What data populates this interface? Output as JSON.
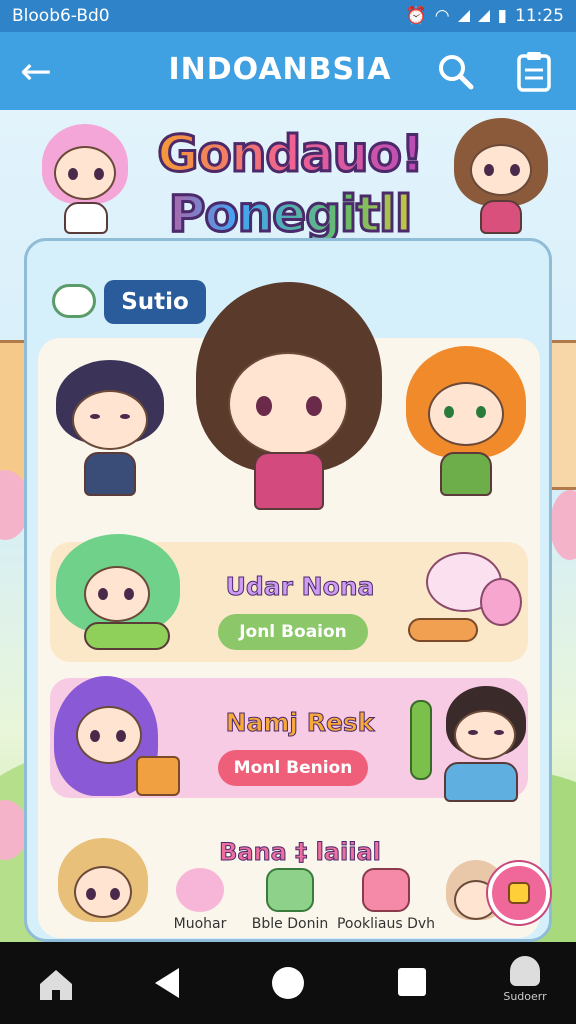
{
  "status_bar": {
    "left_text": "Bloob6-Bd0",
    "time": "11:25"
  },
  "app_bar": {
    "title": "INDOANBSIA"
  },
  "logo": {
    "line1": "Gondauo!",
    "line2": "Ponegitll"
  },
  "section": {
    "label": "Sutio"
  },
  "cards": [
    {
      "title": "Udar Nona",
      "button": "Jonl Boaion"
    },
    {
      "title": "Namj Resk",
      "button": "Monl Benion"
    }
  ],
  "section3": {
    "title": "Bana ‡ laiial"
  },
  "mini_items": [
    {
      "label": "Muohar"
    },
    {
      "label": "Bble Donin"
    },
    {
      "label": "Pookliaus Dvh"
    }
  ],
  "nav": {
    "user_label": "Sudoerr"
  }
}
